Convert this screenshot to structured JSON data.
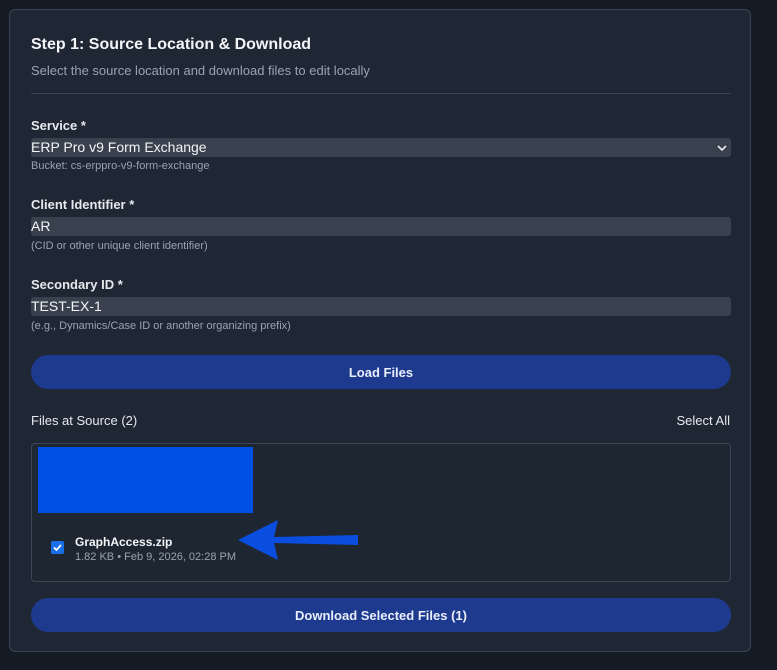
{
  "step": {
    "title": "Step 1: Source Location & Download",
    "subtitle": "Select the source location and download files to edit locally"
  },
  "service": {
    "label": "Service *",
    "value": "ERP Pro v9 Form Exchange",
    "hint": "Bucket: cs-erppro-v9-form-exchange"
  },
  "client": {
    "label": "Client Identifier *",
    "value": "AR",
    "hint": "(CID or other unique client identifier)"
  },
  "secondary": {
    "label": "Secondary ID *",
    "value": "TEST-EX-1",
    "hint": "(e.g., Dynamics/Case ID or another organizing prefix)"
  },
  "actions": {
    "load_label": "Load Files",
    "download_label": "Download Selected Files (1)"
  },
  "files": {
    "heading": "Files at Source (2)",
    "select_all": "Select All",
    "items": [
      {
        "name": "GraphAccess.zip",
        "meta": "1.82 KB • Feb 9, 2026, 02:28 PM",
        "checked": true
      }
    ]
  },
  "colors": {
    "panel_bg": "#1f2734",
    "button_bg": "#1d3a8f",
    "checkbox": "#1a6ee8",
    "annotation_arrow": "#0a4ee0",
    "redaction": "#0050e6"
  }
}
